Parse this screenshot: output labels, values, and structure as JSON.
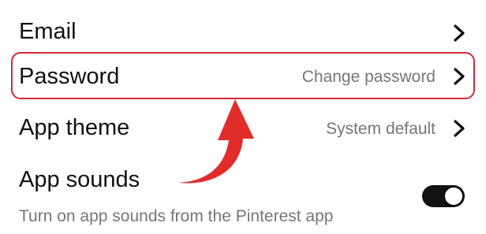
{
  "settings": {
    "email": {
      "label": "Email"
    },
    "password": {
      "label": "Password",
      "value": "Change password"
    },
    "app_theme": {
      "label": "App theme",
      "value": "System default"
    },
    "app_sounds": {
      "label": "App sounds",
      "description": "Turn on app sounds from the Pinterest app",
      "enabled": true
    }
  },
  "colors": {
    "highlight": "#d0283a",
    "arrow": "#e22c2c",
    "toggle_on": "#111111",
    "secondary_text": "#767676"
  },
  "icons": [
    "chevron-right-icon",
    "toggle-switch",
    "annotation-arrow"
  ]
}
